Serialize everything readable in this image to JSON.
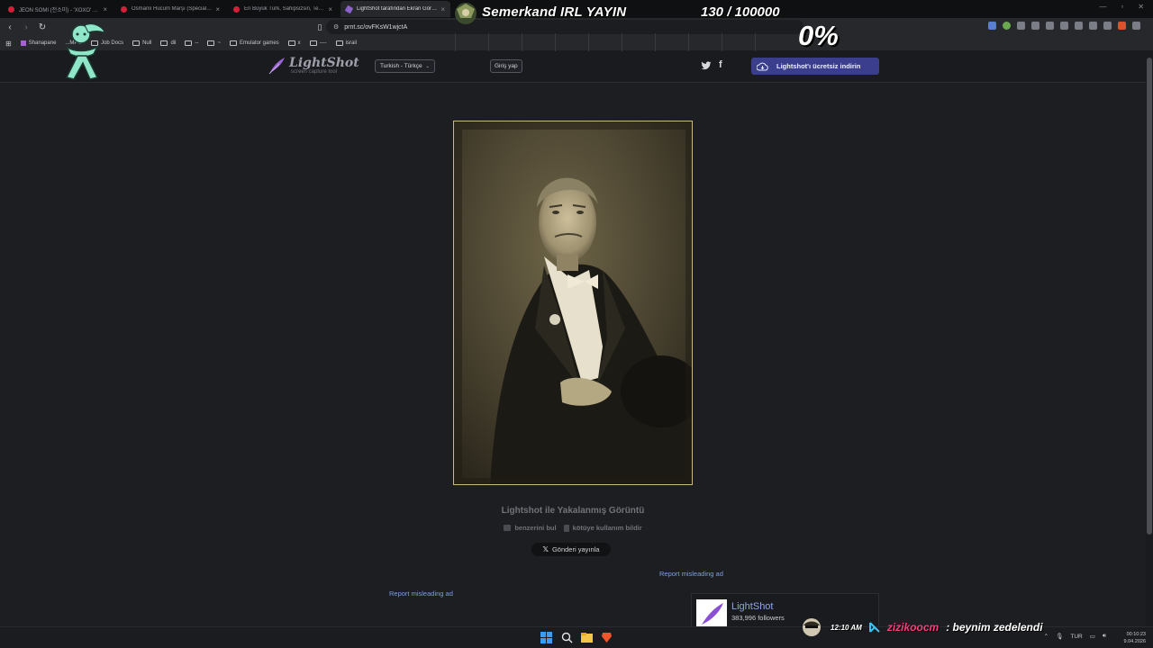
{
  "browser": {
    "tabs": [
      {
        "title": "JEON SOMI (전소미) - 'XOXO' M/V",
        "favicon": "youtube-icon",
        "active": false
      },
      {
        "title": "Osmanlı Hücum Marşı (Special Versi...",
        "favicon": "youtube-icon",
        "active": false
      },
      {
        "title": "En Büyük Türk, Sahipsizsin, Tek Gerçe...",
        "favicon": "youtube-icon",
        "active": false
      },
      {
        "title": "LightShot tarafından Ekran Görü...",
        "favicon": "lightshot-icon",
        "active": true
      }
    ],
    "url": "prnt.sc/ovFKsW1wjctA",
    "bookmarks": [
      {
        "label": "Shanapane",
        "type": "site"
      },
      {
        "label": "...MPG",
        "type": "site"
      },
      {
        "label": "Job Docs",
        "type": "folder"
      },
      {
        "label": "Null",
        "type": "folder"
      },
      {
        "label": "dil",
        "type": "folder"
      },
      {
        "label": "--",
        "type": "folder"
      },
      {
        "label": "~",
        "type": "folder"
      },
      {
        "label": "Emulator games",
        "type": "folder"
      },
      {
        "label": "x",
        "type": "folder"
      },
      {
        "label": "----",
        "type": "folder"
      },
      {
        "label": "israil",
        "type": "folder"
      }
    ]
  },
  "header": {
    "logo_name": "LightShot",
    "logo_tagline": "screen capture tool",
    "language": "Turkish - Türkçe",
    "login": "Giriş yap",
    "download": "Lightshot'ı ücretsiz indirin"
  },
  "main": {
    "caption": "Lightshot ile Yakalanmış Görüntü",
    "find_similar": "benzerini bul",
    "report_abuse": "kötüye kullanım bildir",
    "tweet": "Gönderi yayınla",
    "report_ad_1": "Report misleading ad",
    "report_ad_2": "Report misleading ad",
    "card_name": "LightShot",
    "card_followers": "383,996 followers"
  },
  "overlay": {
    "stream_title": "Semerkand IRL YAYIN",
    "counter": "130 / 100000",
    "percent": "0%",
    "chat_time": "12:10 AM",
    "chat_user": "zizikoocm",
    "chat_message": ": beynim zedelendi"
  },
  "taskbar": {
    "lang": "TUR",
    "time": "00:10:23",
    "date": "9.04.2026"
  },
  "colors": {
    "accent_button": "#3a3e8c",
    "link": "#7b9fe3",
    "chat_user": "#ff3b7f"
  }
}
